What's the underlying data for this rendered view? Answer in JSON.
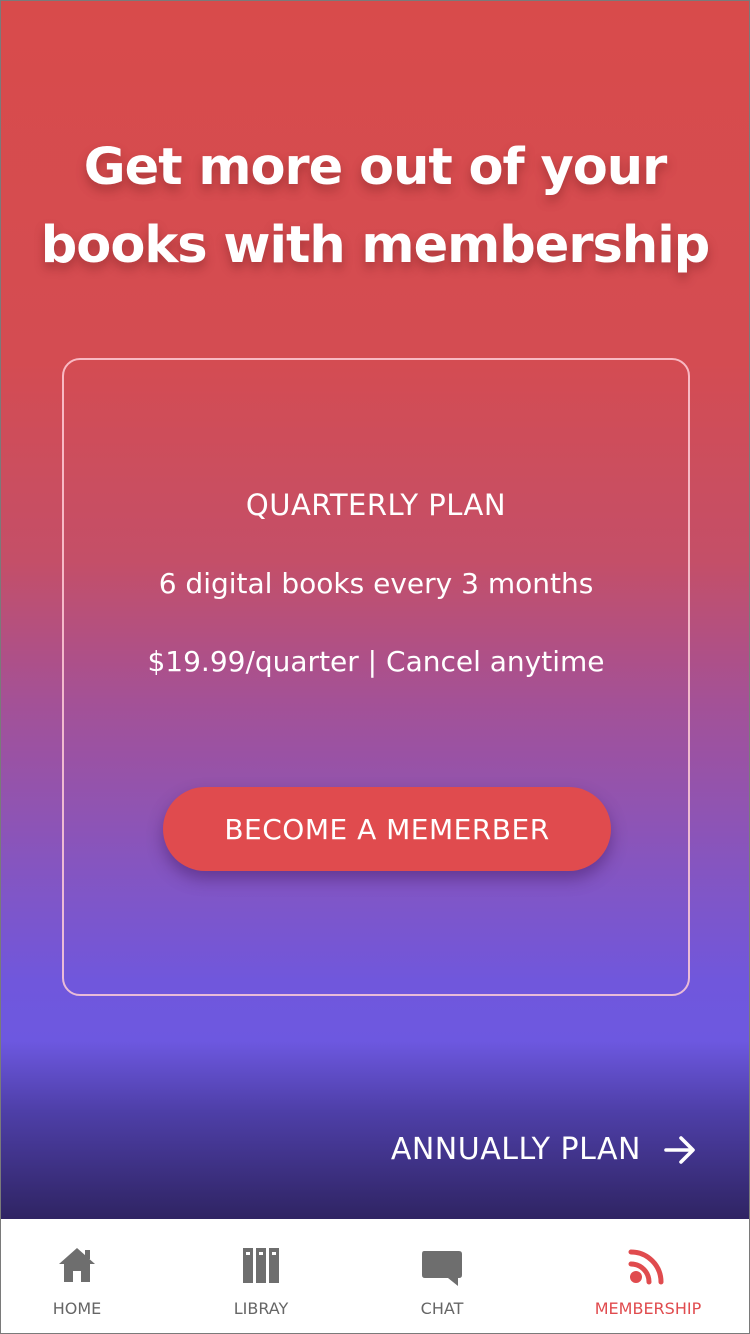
{
  "hero": {
    "headline_line1": "Get more out of your",
    "headline_line2": "books with membership"
  },
  "plan": {
    "title": "QUARTERLY PLAN",
    "description": "6 digital books every 3 months",
    "price_line": "$19.99/quarter | Cancel anytime",
    "cta_label": "BECOME A MEMERBER"
  },
  "next_plan": {
    "label": "ANNUALLY PLAN",
    "icon": "arrow-right-icon"
  },
  "tabbar": {
    "active": "membership",
    "accent_color": "#e04b4e",
    "items": [
      {
        "key": "home",
        "label": "HOME",
        "icon": "home-icon"
      },
      {
        "key": "library",
        "label": "LIBRAY",
        "icon": "library-icon"
      },
      {
        "key": "chat",
        "label": "CHAT",
        "icon": "chat-icon"
      },
      {
        "key": "membership",
        "label": "MEMBERSHIP",
        "icon": "rss-icon"
      }
    ]
  },
  "colors": {
    "gradient_top": "#d84b4b",
    "gradient_mid": "#6d58e0",
    "gradient_bottom": "#2f2463",
    "button_bg": "#e04b4e",
    "icon_gray": "#6e6e6e"
  }
}
